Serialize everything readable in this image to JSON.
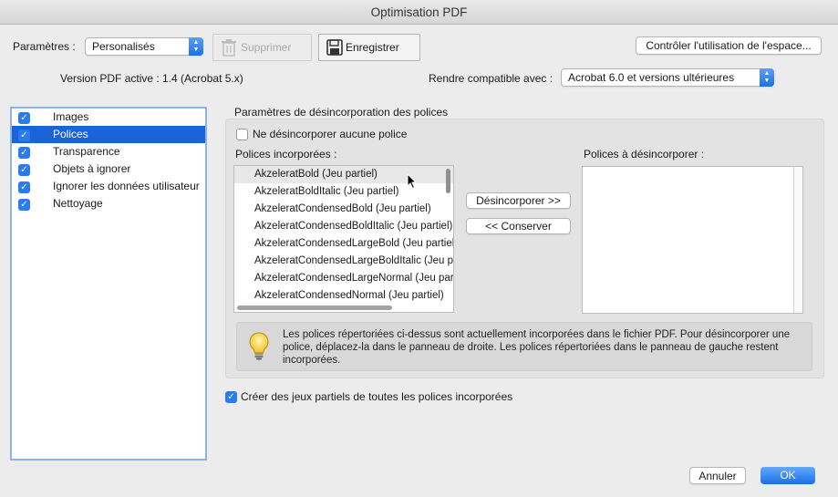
{
  "window": {
    "title": "Optimisation PDF"
  },
  "toolbar": {
    "params_label": "Paramètres :",
    "params_value": "Personalisés",
    "delete_label": "Supprimer",
    "save_label": "Enregistrer",
    "audit_label": "Contrôler l'utilisation de l'espace..."
  },
  "version": {
    "label": "Version PDF active : 1.4 (Acrobat 5.x)",
    "compat_label": "Rendre compatible avec :",
    "compat_value": "Acrobat 6.0 et versions ultérieures"
  },
  "sidebar": {
    "items": [
      {
        "label": "Images",
        "checked": true
      },
      {
        "label": "Polices",
        "checked": true
      },
      {
        "label": "Transparence",
        "checked": true
      },
      {
        "label": "Objets à ignorer",
        "checked": true
      },
      {
        "label": "Ignorer les données utilisateur",
        "checked": true
      },
      {
        "label": "Nettoyage",
        "checked": true
      }
    ],
    "selected_index": 1
  },
  "fonts_panel": {
    "group_title": "Paramètres de désincorporation des polices",
    "no_unembed_label": "Ne désincorporer aucune police",
    "embedded_label": "Polices incorporées :",
    "unembed_label": "Polices à désincorporer :",
    "embedded_fonts": [
      "AkzeleratBold (Jeu partiel)",
      "AkzeleratBoldItalic (Jeu partiel)",
      "AkzeleratCondensedBold (Jeu partiel)",
      "AkzeleratCondensedBoldItalic (Jeu partiel)",
      "AkzeleratCondensedLargeBold (Jeu partiel)",
      "AkzeleratCondensedLargeBoldItalic (Jeu partiel)",
      "AkzeleratCondensedLargeNormal (Jeu partiel)",
      "AkzeleratCondensedNormal (Jeu partiel)"
    ],
    "unembed_button": "Désincorporer >>",
    "keep_button": "<< Conserver",
    "info_text": "Les polices répertoriées ci-dessus sont actuellement incorporées dans le fichier PDF. Pour désincorporer une police, déplacez-la dans le panneau de droite. Les polices répertoriées dans le panneau de gauche restent incorporées.",
    "subset_label": "Créer des jeux partiels de toutes les polices incorporées"
  },
  "footer": {
    "cancel_label": "Annuler",
    "ok_label": "OK"
  },
  "colors": {
    "accent": "#1a63d8",
    "checkbox": "#2b7bf0"
  }
}
